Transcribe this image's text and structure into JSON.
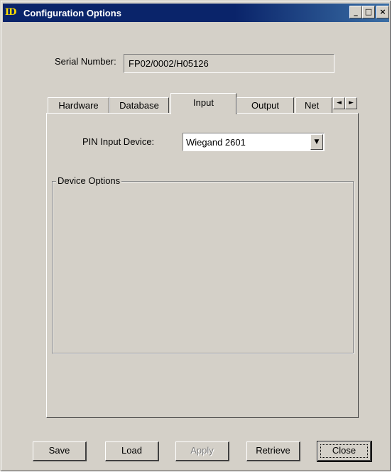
{
  "window": {
    "title": "Configuration Options",
    "icon_text": "ID",
    "icon": "id-app-icon",
    "controls": {
      "minimize": "_",
      "maximize": "□",
      "close": "×"
    }
  },
  "serial": {
    "label": "Serial Number:",
    "value": "FP02/0002/H05126"
  },
  "tabs": [
    {
      "label": "Hardware",
      "active": false
    },
    {
      "label": "Database",
      "active": false
    },
    {
      "label": "Input",
      "active": true
    },
    {
      "label": "Output",
      "active": false
    },
    {
      "label": "Net",
      "active": false
    }
  ],
  "tab_scroll": {
    "left": "◄",
    "right": "►"
  },
  "pin_input": {
    "label": "PIN Input Device:",
    "value": "Wiegand 2601",
    "arrow": "▼"
  },
  "device_options": {
    "label": "Device Options"
  },
  "buttons": {
    "save": "Save",
    "load": "Load",
    "apply": "Apply",
    "retrieve": "Retrieve",
    "close": "Close"
  },
  "colors": {
    "face": "#d4d0c8",
    "title_active": "#0a246a",
    "disabled_text": "#808080"
  }
}
